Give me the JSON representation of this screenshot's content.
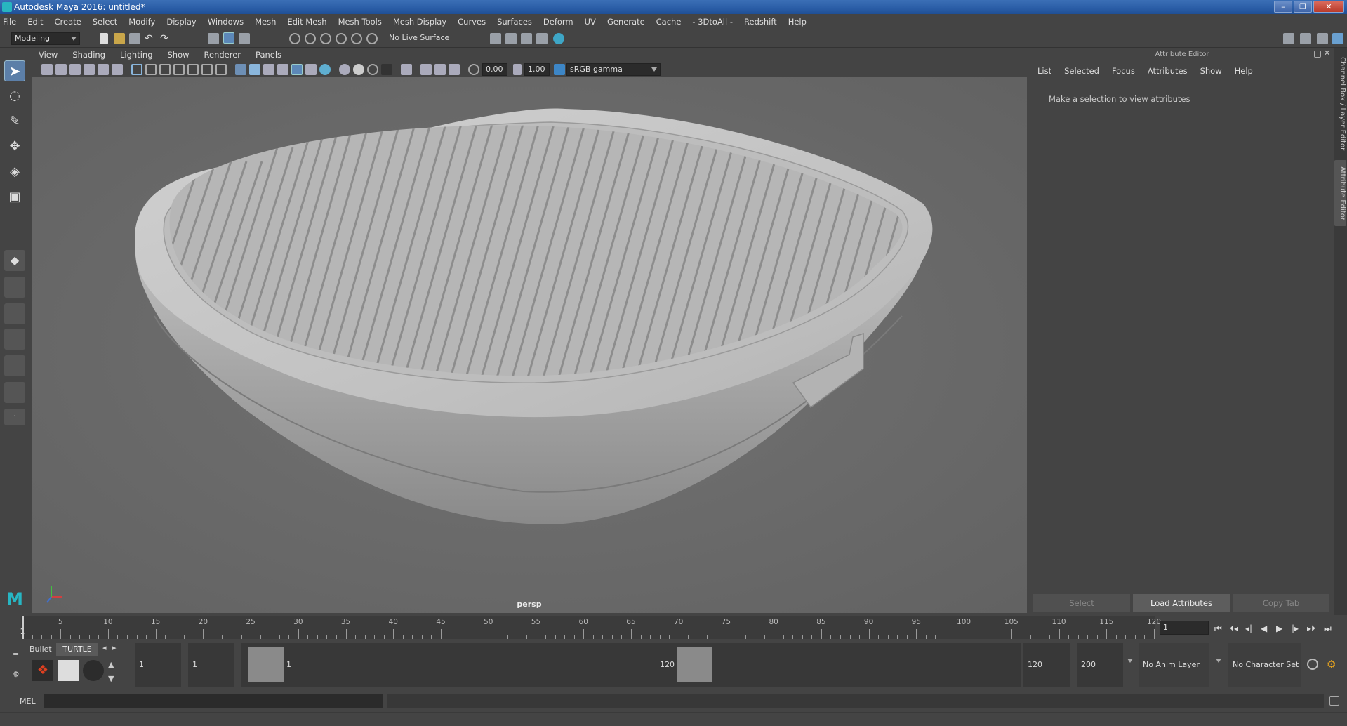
{
  "window": {
    "title": "Autodesk Maya 2016: untitled*",
    "controls": [
      "–",
      "❐",
      "✕"
    ]
  },
  "menubar": [
    "File",
    "Edit",
    "Create",
    "Select",
    "Modify",
    "Display",
    "Windows",
    "Mesh",
    "Edit Mesh",
    "Mesh Tools",
    "Mesh Display",
    "Curves",
    "Surfaces",
    "Deform",
    "UV",
    "Generate",
    "Cache",
    "- 3DtoAll -",
    "Redshift",
    "Help"
  ],
  "shelf": {
    "mode": "Modeling",
    "live_surface": "No Live Surface"
  },
  "viewport": {
    "menu": [
      "View",
      "Shading",
      "Lighting",
      "Show",
      "Renderer",
      "Panels"
    ],
    "exposure": "0.00",
    "gamma": "1.00",
    "color_space": "sRGB gamma",
    "camera": "persp"
  },
  "attribute_editor": {
    "title": "Attribute Editor",
    "menu": [
      "List",
      "Selected",
      "Focus",
      "Attributes",
      "Show",
      "Help"
    ],
    "message": "Make a selection to view attributes",
    "buttons": [
      "Select",
      "Load Attributes",
      "Copy Tab"
    ]
  },
  "side_tabs": [
    "Channel Box / Layer Editor",
    "Attribute Editor"
  ],
  "timeline": {
    "ticks": [
      1,
      5,
      10,
      15,
      20,
      25,
      30,
      35,
      40,
      45,
      50,
      55,
      60,
      65,
      70,
      75,
      80,
      85,
      90,
      95,
      100,
      105,
      110,
      115,
      120
    ],
    "current_frame": "1",
    "playback": [
      "⏮",
      "⏴◂",
      "◂|",
      "◀",
      "▶",
      "|▸",
      "▸⏵",
      "⏭"
    ]
  },
  "range": {
    "shelf_tabs": [
      "Bullet",
      "TURTLE"
    ],
    "start": "1",
    "playback_start": "1",
    "range_start_label": "1",
    "range_end_label": "120",
    "playback_end": "120",
    "end": "200",
    "anim_layer": "No Anim Layer",
    "character_set": "No Character Set"
  },
  "cmdline": {
    "label": "MEL"
  }
}
